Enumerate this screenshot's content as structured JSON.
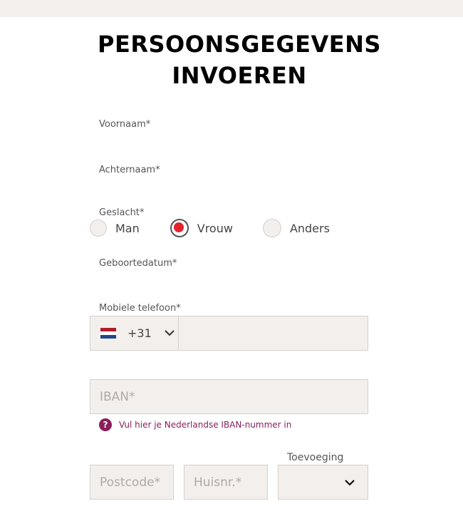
{
  "page": {
    "title_line1": "PERSOONSGEGEVENS",
    "title_line2": "INVOEREN"
  },
  "form": {
    "first_name_label": "Voornaam*",
    "last_name_label": "Achternaam*",
    "gender_label": "Geslacht*",
    "gender_options": [
      {
        "label": "Man",
        "checked": false
      },
      {
        "label": "Vrouw",
        "checked": true
      },
      {
        "label": "Anders",
        "checked": false
      }
    ],
    "birthdate_label": "Geboortedatum*",
    "mobile_label": "Mobiele telefoon*",
    "country_code": "+31",
    "country_flag": "netherlands-flag",
    "iban_placeholder": "IBAN*",
    "iban_hint": "Vul hier je Nederlandse IBAN-nummer in",
    "postcode_placeholder": "Postcode*",
    "housenr_placeholder": "Huisnr.*",
    "addition_label": "Toevoeging"
  },
  "colors": {
    "accent_radio": "#e3232b",
    "hint": "#8a1f5c",
    "field_bg": "#f3efec"
  }
}
